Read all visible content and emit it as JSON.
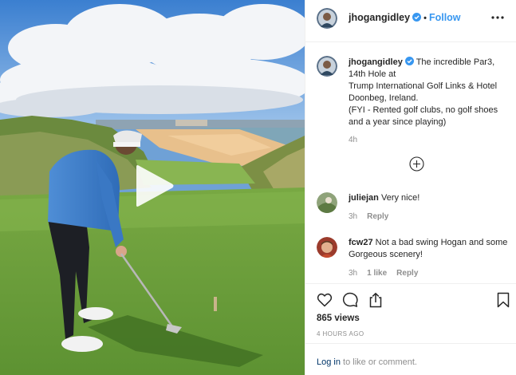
{
  "post": {
    "username": "jhogangidley",
    "header_separator": "•",
    "follow_label": "Follow",
    "caption_text": "The incredible Par3, 14th Hole at\nTrump International Golf Links & Hotel Doonbeg, Ireland.\n(FYI - Rented golf clubs, no golf shoes and a year since playing)",
    "caption_time": "4h",
    "views": "865 views",
    "posted_ago": "4 HOURS AGO"
  },
  "comments": [
    {
      "username": "juliejan",
      "text": "Very nice!",
      "time": "3h",
      "reply_label": "Reply"
    },
    {
      "username": "fcw27",
      "text": "Not a bad swing Hogan and some Gorgeous scenery!",
      "time": "3h",
      "likes": "1 like",
      "reply_label": "Reply"
    }
  ],
  "login": {
    "link_label": "Log in",
    "rest": " to like or comment."
  },
  "icons": {
    "verified": "verified-badge-icon",
    "more": "more-options-icon",
    "load_more": "plus-circle-icon",
    "like": "heart-icon",
    "comment": "comment-bubble-icon",
    "share": "share-icon",
    "save": "bookmark-icon",
    "play": "play-icon"
  },
  "colors": {
    "link_blue": "#3897f0",
    "text": "#262626",
    "muted": "#8e8e8e",
    "border": "#efefef",
    "login_link": "#003569"
  }
}
